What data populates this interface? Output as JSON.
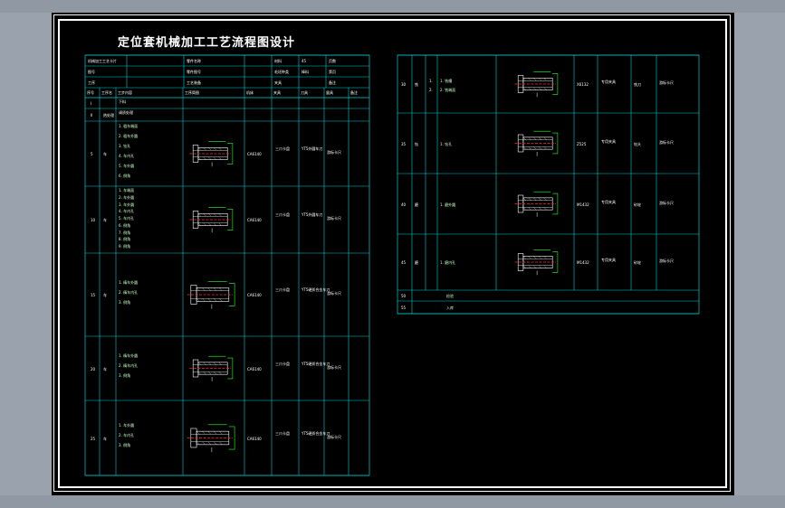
{
  "title": "定位套机械加工工艺流程图设计",
  "colors": {
    "background": "#000000",
    "grid": "#00d0d0",
    "part_outline": "#ffffff",
    "cut_line": "#ff2a2a",
    "dimension": "#2bff2b",
    "frame": "#ffffff",
    "viewport_bg": "#9aa3ad"
  },
  "left_table": {
    "header_rows": [
      [
        "机械加工工艺卡片",
        "",
        "零件名称",
        "",
        "材料",
        "45",
        "页数"
      ],
      [
        "图号",
        "",
        "零件图号",
        "",
        "毛坯种类",
        "棒料",
        "第页"
      ],
      [
        "工序",
        "",
        "工艺装备",
        "",
        "夹具",
        "",
        "备注"
      ]
    ],
    "col_headers": [
      "序号",
      "工序名",
      "工步内容",
      "工序简图",
      "机床",
      "夹具",
      "刀具",
      "量具",
      "备注"
    ],
    "rows": [
      {
        "no": "I",
        "name": "",
        "steps": [
          "下料"
        ]
      },
      {
        "no": "II",
        "name": "热处理",
        "steps": [
          "调质处理"
        ]
      },
      {
        "no": "5",
        "name": "车",
        "steps": [
          "1. 粗车端面",
          "2. 粗车外圆",
          "3. 钻孔",
          "4. 车内孔",
          "5. 车外圆",
          "6. 倒角"
        ],
        "machine": "CA6140",
        "fixture": "三爪卡盘",
        "tool": "YT5外圆车刀",
        "gauge": "游标卡尺"
      },
      {
        "no": "10",
        "name": "车",
        "steps": [
          "1. 车端面",
          "2. 车外圆",
          "3. 车外圆",
          "4. 车内孔",
          "5. 车内孔",
          "6. 倒角",
          "7. 倒角",
          "8. 倒角",
          "9. 倒角"
        ],
        "machine": "CA6140",
        "fixture": "三爪卡盘",
        "tool": "YT5外圆车刀",
        "gauge": "游标卡尺"
      },
      {
        "no": "15",
        "name": "车",
        "steps": [
          "1. 精车外圆",
          "2. 精车内孔",
          "3. 倒角"
        ],
        "machine": "CA6140",
        "fixture": "三爪卡盘",
        "tool": "YT5硬质合金车刀",
        "gauge": "游标卡尺"
      },
      {
        "no": "20",
        "name": "车",
        "steps": [
          "1. 精车外圆",
          "2. 精车内孔",
          "3. 倒角"
        ],
        "machine": "CA6140",
        "fixture": "三爪卡盘",
        "tool": "YT5硬质合金车刀",
        "gauge": "游标卡尺"
      },
      {
        "no": "25",
        "name": "车",
        "steps": [
          "1. 车外圆",
          "2. 车内孔",
          "3. 倒角"
        ],
        "machine": "CA6140",
        "fixture": "三爪卡盘",
        "tool": "YT5硬质合金车刀",
        "gauge": "游标卡尺"
      }
    ]
  },
  "right_table": {
    "rows": [
      {
        "no": "30",
        "name": "铣",
        "steps": [
          "1. 铣槽",
          "2. 铣端面"
        ],
        "machine": "X6132",
        "fixture": "专用夹具",
        "tool": "铣刀",
        "gauge": "游标卡尺"
      },
      {
        "no": "35",
        "name": "钻",
        "steps": [
          "1. 钻孔"
        ],
        "machine": "Z525",
        "fixture": "专用夹具",
        "tool": "钻头",
        "gauge": "游标卡尺"
      },
      {
        "no": "40",
        "name": "磨",
        "steps": [
          "1. 磨外圆"
        ],
        "machine": "M1432",
        "fixture": "专用夹具",
        "tool": "砂轮",
        "gauge": "游标卡尺"
      },
      {
        "no": "45",
        "name": "磨",
        "steps": [
          "1. 磨内孔"
        ],
        "machine": "M1432",
        "fixture": "专用夹具",
        "tool": "砂轮",
        "gauge": "游标卡尺"
      },
      {
        "no": "50",
        "name": "",
        "steps": [
          "检验"
        ]
      },
      {
        "no": "55",
        "name": "",
        "steps": [
          "入库"
        ]
      }
    ]
  }
}
